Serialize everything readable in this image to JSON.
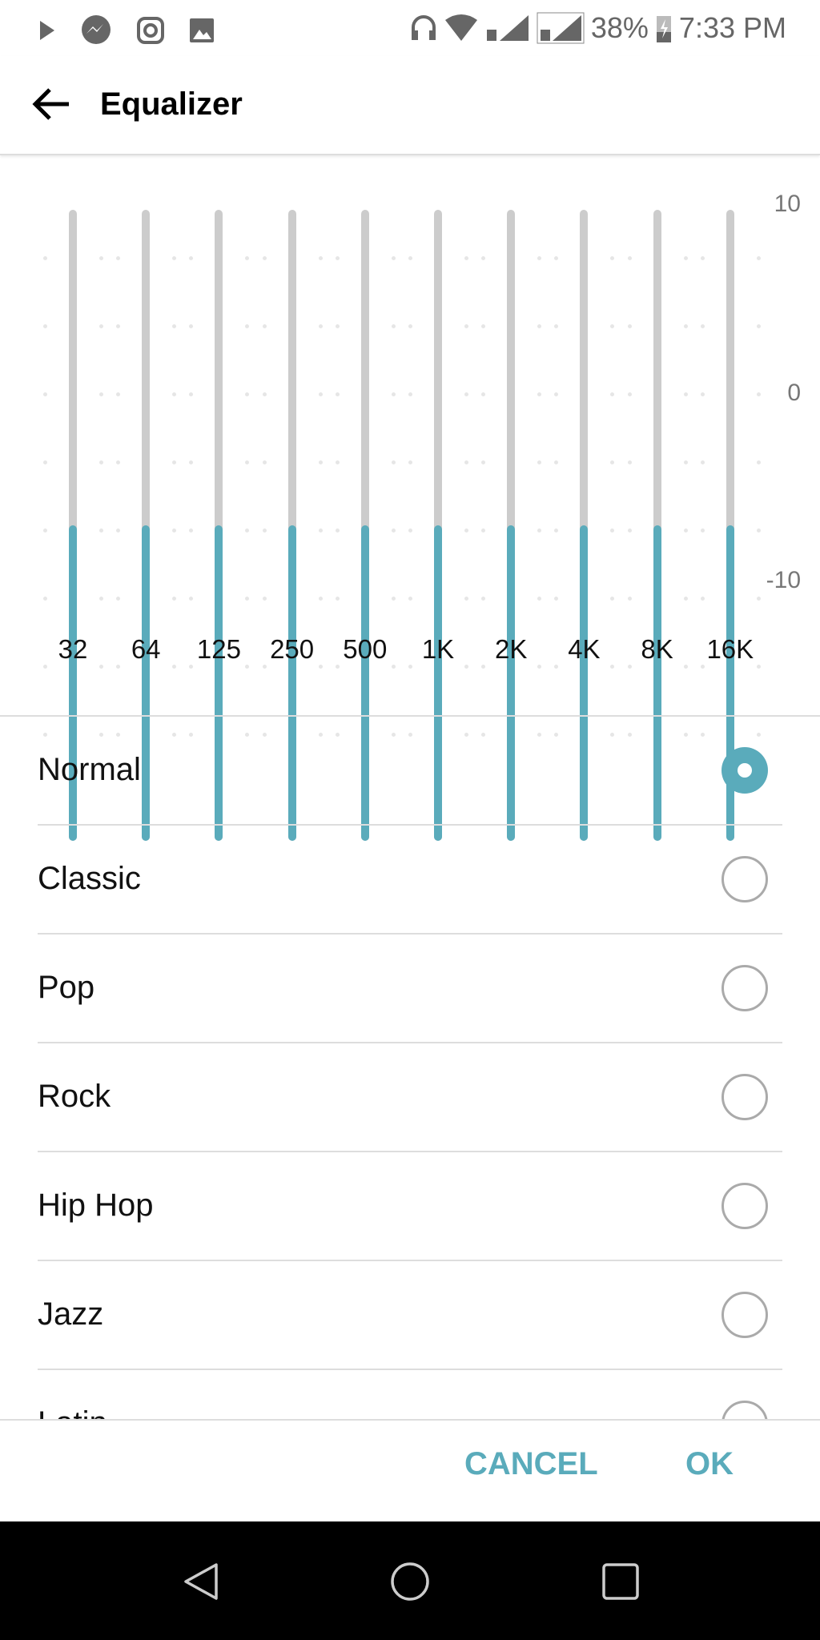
{
  "status_bar": {
    "icons_left": [
      "play-store-icon",
      "messenger-icon",
      "instagram-icon",
      "gallery-icon"
    ],
    "icons_right": [
      "headset-icon",
      "wifi-icon",
      "signal-sim1-icon",
      "signal-sim2-icon"
    ],
    "battery": "38%",
    "time": "7:33 PM"
  },
  "header": {
    "title": "Equalizer",
    "back_icon": "arrow-left-icon"
  },
  "equalizer": {
    "accent": "#5aabbb",
    "track": "#cccccc",
    "y_labels": [
      "10",
      "0",
      "-10"
    ],
    "range": [
      -10,
      10
    ],
    "bands": [
      {
        "label": "32",
        "value": 0
      },
      {
        "label": "64",
        "value": 0
      },
      {
        "label": "125",
        "value": 0
      },
      {
        "label": "250",
        "value": 0
      },
      {
        "label": "500",
        "value": 0
      },
      {
        "label": "1K",
        "value": 0
      },
      {
        "label": "2K",
        "value": 0
      },
      {
        "label": "4K",
        "value": 0
      },
      {
        "label": "8K",
        "value": 0
      },
      {
        "label": "16K",
        "value": 0
      }
    ]
  },
  "presets": [
    {
      "label": "Normal",
      "selected": true
    },
    {
      "label": "Classic",
      "selected": false
    },
    {
      "label": "Pop",
      "selected": false
    },
    {
      "label": "Rock",
      "selected": false
    },
    {
      "label": "Hip Hop",
      "selected": false
    },
    {
      "label": "Jazz",
      "selected": false
    },
    {
      "label": "Latin",
      "selected": false
    }
  ],
  "footer": {
    "cancel": "CANCEL",
    "ok": "OK"
  },
  "nav": {
    "icons": [
      "back-triangle-icon",
      "home-circle-icon",
      "recents-square-icon"
    ]
  }
}
